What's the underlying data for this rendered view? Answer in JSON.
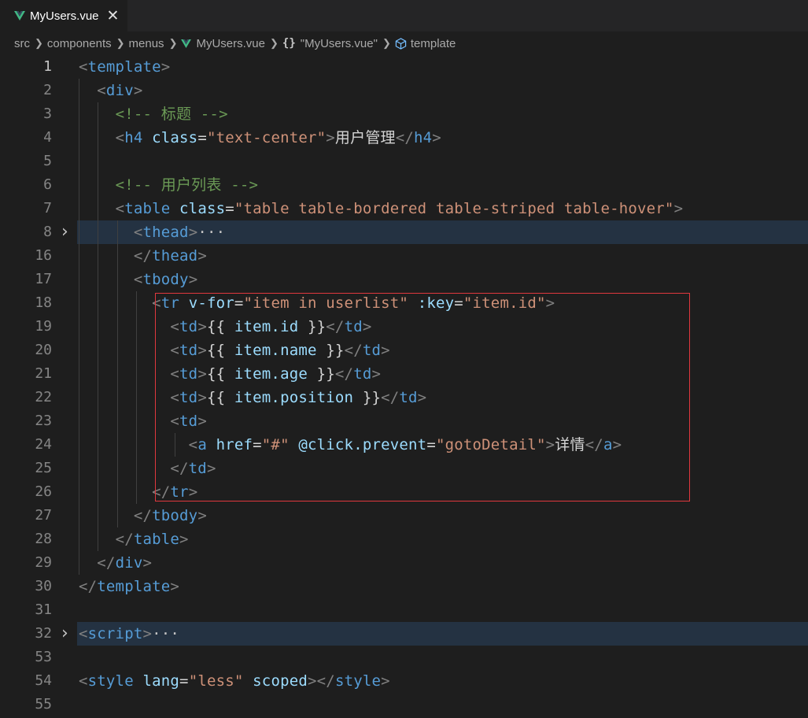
{
  "tab": {
    "title": "MyUsers.vue",
    "close": "✕"
  },
  "breadcrumb": {
    "items": [
      "src",
      "components",
      "menus",
      "MyUsers.vue",
      "\"MyUsers.vue\"",
      "template"
    ],
    "brace": "{}"
  },
  "colors": {
    "tag": "#569cd6",
    "attr": "#9cdcfe",
    "string": "#ce9178",
    "comment": "#6a9955",
    "selection_border": "#e0383e"
  },
  "lines": [
    {
      "n": "1",
      "text": "<template>"
    },
    {
      "n": "2",
      "text": "  <div>"
    },
    {
      "n": "3",
      "text": "    <!-- 标题 -->"
    },
    {
      "n": "4",
      "text": "    <h4 class=\"text-center\">用户管理</h4>"
    },
    {
      "n": "5",
      "text": ""
    },
    {
      "n": "6",
      "text": "    <!-- 用户列表 -->"
    },
    {
      "n": "7",
      "text": "    <table class=\"table table-bordered table-striped table-hover\">"
    },
    {
      "n": "8",
      "text": "      <thead>···"
    },
    {
      "n": "16",
      "text": "      </thead>"
    },
    {
      "n": "17",
      "text": "      <tbody>"
    },
    {
      "n": "18",
      "text": "        <tr v-for=\"item in userlist\" :key=\"item.id\">"
    },
    {
      "n": "19",
      "text": "          <td>{{ item.id }}</td>"
    },
    {
      "n": "20",
      "text": "          <td>{{ item.name }}</td>"
    },
    {
      "n": "21",
      "text": "          <td>{{ item.age }}</td>"
    },
    {
      "n": "22",
      "text": "          <td>{{ item.position }}</td>"
    },
    {
      "n": "23",
      "text": "          <td>"
    },
    {
      "n": "24",
      "text": "            <a href=\"#\" @click.prevent=\"gotoDetail\">详情</a>"
    },
    {
      "n": "25",
      "text": "          </td>"
    },
    {
      "n": "26",
      "text": "        </tr>"
    },
    {
      "n": "27",
      "text": "      </tbody>"
    },
    {
      "n": "28",
      "text": "    </table>"
    },
    {
      "n": "29",
      "text": "  </div>"
    },
    {
      "n": "30",
      "text": "</template>"
    },
    {
      "n": "31",
      "text": ""
    },
    {
      "n": "32",
      "text": "<script>···"
    },
    {
      "n": "53",
      "text": ""
    },
    {
      "n": "54",
      "text": "<style lang=\"less\" scoped></style>"
    },
    {
      "n": "55",
      "text": ""
    }
  ]
}
